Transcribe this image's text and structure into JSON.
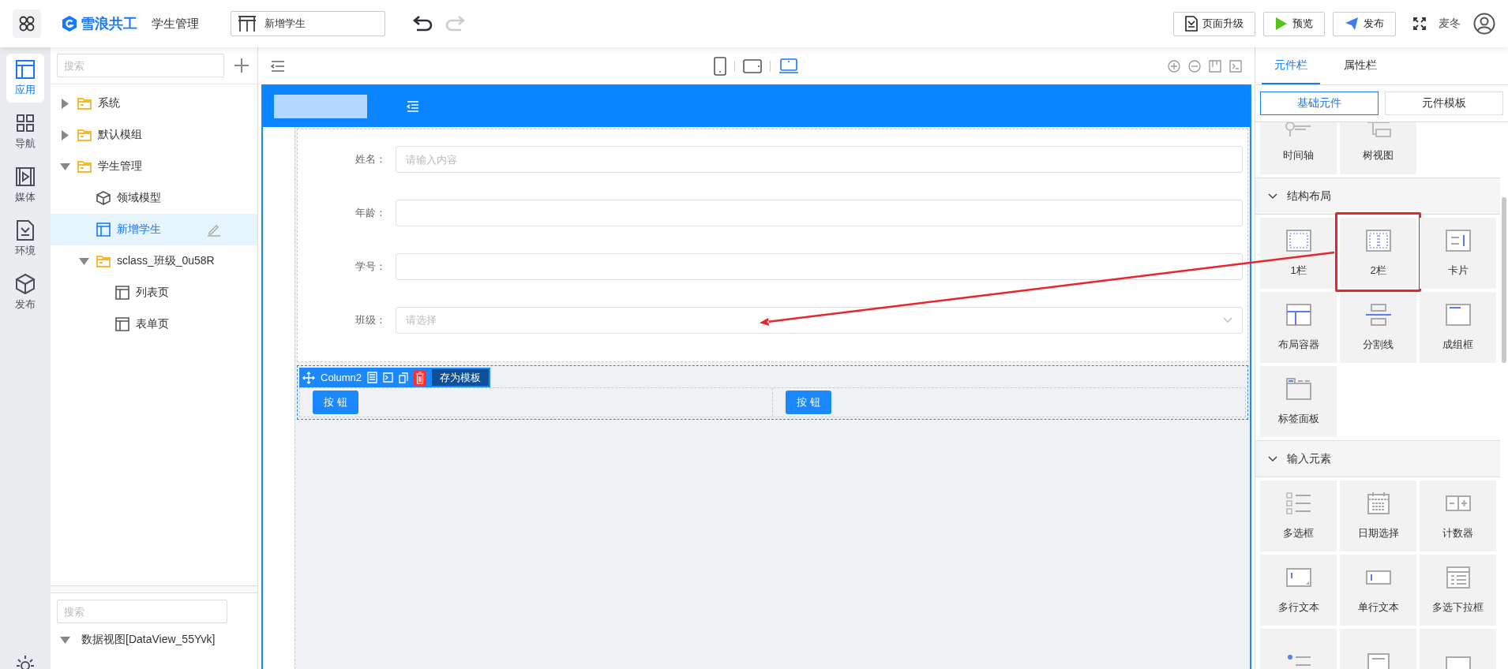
{
  "header": {
    "brand": "雪浪共工",
    "app_name": "学生管理",
    "page_select": "新增学生",
    "history": [
      {
        "kind": "undo",
        "disabled": false
      },
      {
        "kind": "redo",
        "disabled": true
      }
    ],
    "actions": [
      {
        "label": "页面升级",
        "kind": "upgrade"
      },
      {
        "label": "预览",
        "kind": "preview"
      },
      {
        "label": "发布",
        "kind": "publish"
      }
    ],
    "user": "麦冬"
  },
  "nav_rail": [
    {
      "label": "应用",
      "kind": "app",
      "selected": true
    },
    {
      "label": "导航",
      "kind": "nav",
      "selected": false
    },
    {
      "label": "媒体",
      "kind": "media",
      "selected": false
    },
    {
      "label": "环境",
      "kind": "env",
      "selected": false
    },
    {
      "label": "发布",
      "kind": "publish",
      "selected": false
    }
  ],
  "tree": {
    "search": {
      "placeholder": "搜索"
    },
    "items": [
      {
        "label": "系统",
        "kind": "folder",
        "expanded": false,
        "selected": false
      },
      {
        "label": "默认模组",
        "kind": "folder",
        "expanded": false,
        "selected": false
      },
      {
        "label": "学生管理",
        "kind": "folder",
        "expanded": true,
        "selected": false,
        "children": [
          {
            "label": "领域模型",
            "kind": "model",
            "selected": false
          },
          {
            "label": "新增学生",
            "kind": "page",
            "selected": true
          },
          {
            "label": "sclass_班级_0u58R",
            "kind": "folder",
            "expanded": true,
            "selected": false,
            "children": [
              {
                "label": "列表页",
                "kind": "page",
                "selected": false
              },
              {
                "label": "表单页",
                "kind": "page",
                "selected": false
              }
            ]
          }
        ]
      }
    ]
  },
  "data_panel": {
    "search": {
      "placeholder": "搜索"
    },
    "items": [
      {
        "label": "数据视图[DataView_55Yvk]",
        "expanded": true
      }
    ]
  },
  "canvas": {
    "devices": [
      {
        "kind": "phone",
        "selected": false
      },
      {
        "kind": "tablet",
        "selected": false
      },
      {
        "kind": "laptop",
        "selected": true
      }
    ],
    "form": [
      {
        "label": "姓名：",
        "kind": "input",
        "placeholder": "请输入内容"
      },
      {
        "label": "年龄：",
        "kind": "input"
      },
      {
        "label": "学号：",
        "kind": "input"
      },
      {
        "label": "班级：",
        "kind": "select",
        "placeholder": "请选择"
      }
    ],
    "column_component": {
      "name": "Column2",
      "save_template": "存为模板",
      "columns": [
        {
          "button": "按 钮"
        },
        {
          "button": "按 钮"
        }
      ]
    }
  },
  "palette": {
    "tabs": [
      {
        "label": "元件栏",
        "selected": true
      },
      {
        "label": "属性栏",
        "selected": false
      }
    ],
    "subtabs": [
      {
        "label": "基础元件",
        "selected": true
      },
      {
        "label": "元件模板",
        "selected": false
      }
    ],
    "top_items": [
      {
        "label": "时间轴",
        "kind": "timeline"
      },
      {
        "label": "树视图",
        "kind": "tree"
      }
    ],
    "sections": [
      {
        "title": "结构布局",
        "expanded": true,
        "items": [
          {
            "label": "1栏",
            "kind": "col1",
            "highlighted": false
          },
          {
            "label": "2栏",
            "kind": "col2",
            "highlighted": true
          },
          {
            "label": "卡片",
            "kind": "card",
            "highlighted": false
          },
          {
            "label": "布局容器",
            "kind": "layout",
            "highlighted": false
          },
          {
            "label": "分割线",
            "kind": "divider",
            "highlighted": false
          },
          {
            "label": "成组框",
            "kind": "groupbox",
            "highlighted": false
          },
          {
            "label": "标签面板",
            "kind": "tabs",
            "highlighted": false
          }
        ]
      },
      {
        "title": "输入元素",
        "expanded": true,
        "items": [
          {
            "label": "多选框",
            "kind": "checkbox",
            "highlighted": false
          },
          {
            "label": "日期选择",
            "kind": "date",
            "highlighted": false
          },
          {
            "label": "计数器",
            "kind": "counter",
            "highlighted": false
          },
          {
            "label": "多行文本",
            "kind": "textarea",
            "highlighted": false
          },
          {
            "label": "单行文本",
            "kind": "input",
            "highlighted": false
          },
          {
            "label": "多选下拉框",
            "kind": "multiselect",
            "highlighted": false
          },
          {
            "kind": "radio",
            "highlighted": false
          },
          {
            "kind": "form",
            "highlighted": false
          },
          {
            "kind": "box",
            "highlighted": false
          }
        ]
      }
    ]
  }
}
